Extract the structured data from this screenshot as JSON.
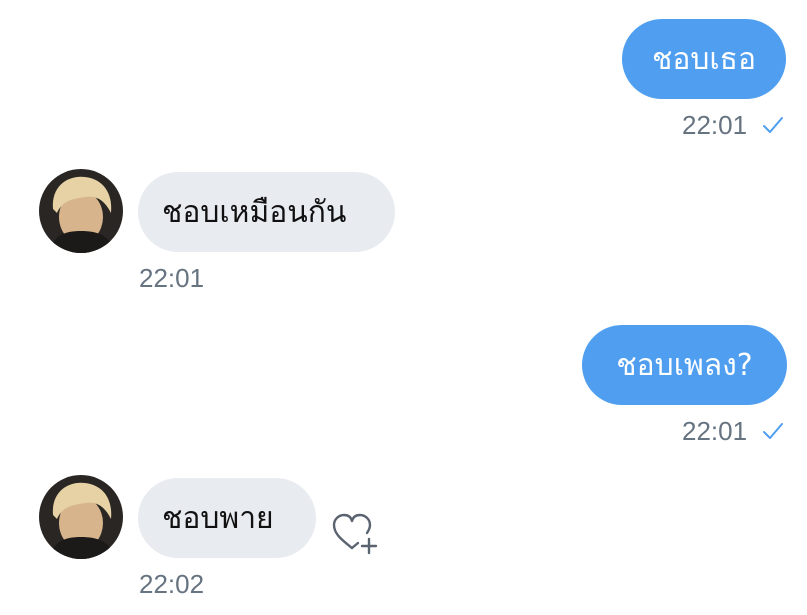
{
  "conversation": {
    "messages": [
      {
        "direction": "outgoing",
        "text": "ชอบเธอ",
        "time": "22:01",
        "status_icon": "check-icon"
      },
      {
        "direction": "incoming",
        "text": "ชอบเหมือนกัน",
        "time": "22:01",
        "avatar": "avatar"
      },
      {
        "direction": "outgoing",
        "text": "ชอบเพลง?",
        "time": "22:01",
        "status_icon": "check-icon"
      },
      {
        "direction": "incoming",
        "text": "ชอบพาย",
        "time": "22:02",
        "avatar": "avatar",
        "reaction_icon": "heart-plus-icon"
      }
    ]
  },
  "colors": {
    "outgoing_bubble": "#4f9ef0",
    "incoming_bubble": "#e8ebf0",
    "timestamp": "#667380",
    "check": "#4f9ef0"
  }
}
